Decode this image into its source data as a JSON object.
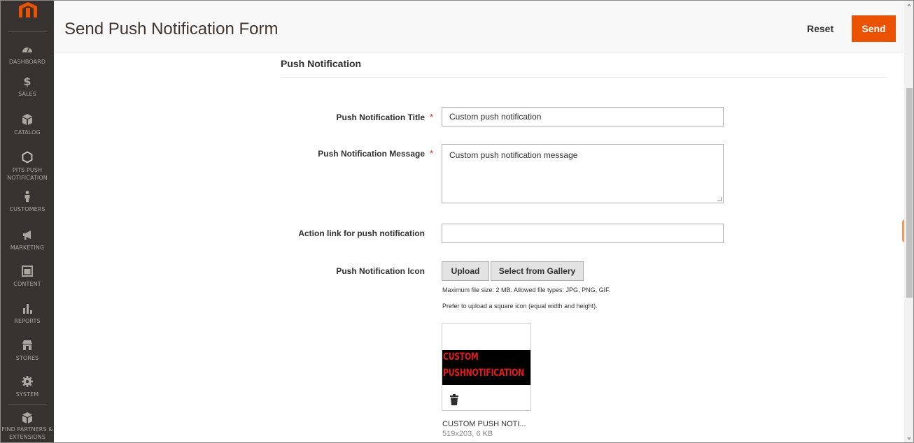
{
  "header": {
    "title": "Send Push Notification Form",
    "reset_label": "Reset",
    "send_label": "Send"
  },
  "sidebar": {
    "items": [
      {
        "label": "DASHBOARD",
        "icon": "dashboard-icon"
      },
      {
        "label": "SALES",
        "icon": "dollar-icon"
      },
      {
        "label": "CATALOG",
        "icon": "box-icon"
      },
      {
        "label": "PITS PUSH NOTIFICATION",
        "icon": "hexagon-icon"
      },
      {
        "label": "CUSTOMERS",
        "icon": "person-icon"
      },
      {
        "label": "MARKETING",
        "icon": "megaphone-icon"
      },
      {
        "label": "CONTENT",
        "icon": "layout-icon"
      },
      {
        "label": "REPORTS",
        "icon": "bar-chart-icon"
      },
      {
        "label": "STORES",
        "icon": "store-icon"
      },
      {
        "label": "SYSTEM",
        "icon": "gear-icon"
      },
      {
        "label": "FIND PARTNERS & EXTENSIONS",
        "icon": "extensions-icon"
      }
    ]
  },
  "form": {
    "section_title": "Push Notification",
    "title_label": "Push Notification Title",
    "title_value": "Custom push notification",
    "message_label": "Push Notification Message",
    "message_value": "Custom push notification message",
    "action_label": "Action link for push notification",
    "action_value": "",
    "icon_label": "Push Notification Icon",
    "upload_label": "Upload",
    "gallery_label": "Select from Gallery",
    "note_size": "Maximum file size: 2 MB. Allowed file types: JPG, PNG, GIF.",
    "note_square": "Prefer to upload a square icon (equal width and height).",
    "required_mark": "*"
  },
  "preview": {
    "image_line1": "CUSTOM",
    "image_line2": "PUSHNOTIFICATION",
    "file_name": "CUSTOM PUSH NOTI...",
    "file_meta": "519x203, 6 KB"
  },
  "colors": {
    "sidebar_bg": "#373330",
    "accent": "#eb5202",
    "required": "#e22626"
  }
}
